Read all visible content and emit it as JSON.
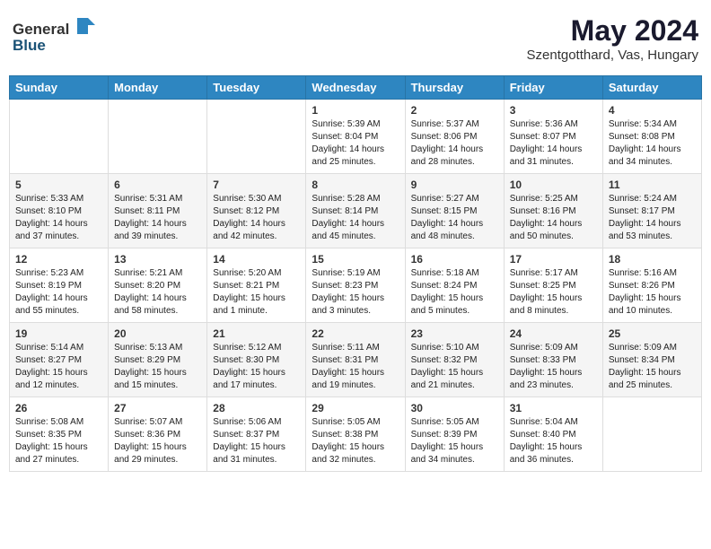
{
  "header": {
    "logo_general": "General",
    "logo_blue": "Blue",
    "month_title": "May 2024",
    "location": "Szentgotthard, Vas, Hungary"
  },
  "weekdays": [
    "Sunday",
    "Monday",
    "Tuesday",
    "Wednesday",
    "Thursday",
    "Friday",
    "Saturday"
  ],
  "weeks": [
    [
      {
        "day": "",
        "info": ""
      },
      {
        "day": "",
        "info": ""
      },
      {
        "day": "",
        "info": ""
      },
      {
        "day": "1",
        "info": "Sunrise: 5:39 AM\nSunset: 8:04 PM\nDaylight: 14 hours\nand 25 minutes."
      },
      {
        "day": "2",
        "info": "Sunrise: 5:37 AM\nSunset: 8:06 PM\nDaylight: 14 hours\nand 28 minutes."
      },
      {
        "day": "3",
        "info": "Sunrise: 5:36 AM\nSunset: 8:07 PM\nDaylight: 14 hours\nand 31 minutes."
      },
      {
        "day": "4",
        "info": "Sunrise: 5:34 AM\nSunset: 8:08 PM\nDaylight: 14 hours\nand 34 minutes."
      }
    ],
    [
      {
        "day": "5",
        "info": "Sunrise: 5:33 AM\nSunset: 8:10 PM\nDaylight: 14 hours\nand 37 minutes."
      },
      {
        "day": "6",
        "info": "Sunrise: 5:31 AM\nSunset: 8:11 PM\nDaylight: 14 hours\nand 39 minutes."
      },
      {
        "day": "7",
        "info": "Sunrise: 5:30 AM\nSunset: 8:12 PM\nDaylight: 14 hours\nand 42 minutes."
      },
      {
        "day": "8",
        "info": "Sunrise: 5:28 AM\nSunset: 8:14 PM\nDaylight: 14 hours\nand 45 minutes."
      },
      {
        "day": "9",
        "info": "Sunrise: 5:27 AM\nSunset: 8:15 PM\nDaylight: 14 hours\nand 48 minutes."
      },
      {
        "day": "10",
        "info": "Sunrise: 5:25 AM\nSunset: 8:16 PM\nDaylight: 14 hours\nand 50 minutes."
      },
      {
        "day": "11",
        "info": "Sunrise: 5:24 AM\nSunset: 8:17 PM\nDaylight: 14 hours\nand 53 minutes."
      }
    ],
    [
      {
        "day": "12",
        "info": "Sunrise: 5:23 AM\nSunset: 8:19 PM\nDaylight: 14 hours\nand 55 minutes."
      },
      {
        "day": "13",
        "info": "Sunrise: 5:21 AM\nSunset: 8:20 PM\nDaylight: 14 hours\nand 58 minutes."
      },
      {
        "day": "14",
        "info": "Sunrise: 5:20 AM\nSunset: 8:21 PM\nDaylight: 15 hours\nand 1 minute."
      },
      {
        "day": "15",
        "info": "Sunrise: 5:19 AM\nSunset: 8:23 PM\nDaylight: 15 hours\nand 3 minutes."
      },
      {
        "day": "16",
        "info": "Sunrise: 5:18 AM\nSunset: 8:24 PM\nDaylight: 15 hours\nand 5 minutes."
      },
      {
        "day": "17",
        "info": "Sunrise: 5:17 AM\nSunset: 8:25 PM\nDaylight: 15 hours\nand 8 minutes."
      },
      {
        "day": "18",
        "info": "Sunrise: 5:16 AM\nSunset: 8:26 PM\nDaylight: 15 hours\nand 10 minutes."
      }
    ],
    [
      {
        "day": "19",
        "info": "Sunrise: 5:14 AM\nSunset: 8:27 PM\nDaylight: 15 hours\nand 12 minutes."
      },
      {
        "day": "20",
        "info": "Sunrise: 5:13 AM\nSunset: 8:29 PM\nDaylight: 15 hours\nand 15 minutes."
      },
      {
        "day": "21",
        "info": "Sunrise: 5:12 AM\nSunset: 8:30 PM\nDaylight: 15 hours\nand 17 minutes."
      },
      {
        "day": "22",
        "info": "Sunrise: 5:11 AM\nSunset: 8:31 PM\nDaylight: 15 hours\nand 19 minutes."
      },
      {
        "day": "23",
        "info": "Sunrise: 5:10 AM\nSunset: 8:32 PM\nDaylight: 15 hours\nand 21 minutes."
      },
      {
        "day": "24",
        "info": "Sunrise: 5:09 AM\nSunset: 8:33 PM\nDaylight: 15 hours\nand 23 minutes."
      },
      {
        "day": "25",
        "info": "Sunrise: 5:09 AM\nSunset: 8:34 PM\nDaylight: 15 hours\nand 25 minutes."
      }
    ],
    [
      {
        "day": "26",
        "info": "Sunrise: 5:08 AM\nSunset: 8:35 PM\nDaylight: 15 hours\nand 27 minutes."
      },
      {
        "day": "27",
        "info": "Sunrise: 5:07 AM\nSunset: 8:36 PM\nDaylight: 15 hours\nand 29 minutes."
      },
      {
        "day": "28",
        "info": "Sunrise: 5:06 AM\nSunset: 8:37 PM\nDaylight: 15 hours\nand 31 minutes."
      },
      {
        "day": "29",
        "info": "Sunrise: 5:05 AM\nSunset: 8:38 PM\nDaylight: 15 hours\nand 32 minutes."
      },
      {
        "day": "30",
        "info": "Sunrise: 5:05 AM\nSunset: 8:39 PM\nDaylight: 15 hours\nand 34 minutes."
      },
      {
        "day": "31",
        "info": "Sunrise: 5:04 AM\nSunset: 8:40 PM\nDaylight: 15 hours\nand 36 minutes."
      },
      {
        "day": "",
        "info": ""
      }
    ]
  ]
}
